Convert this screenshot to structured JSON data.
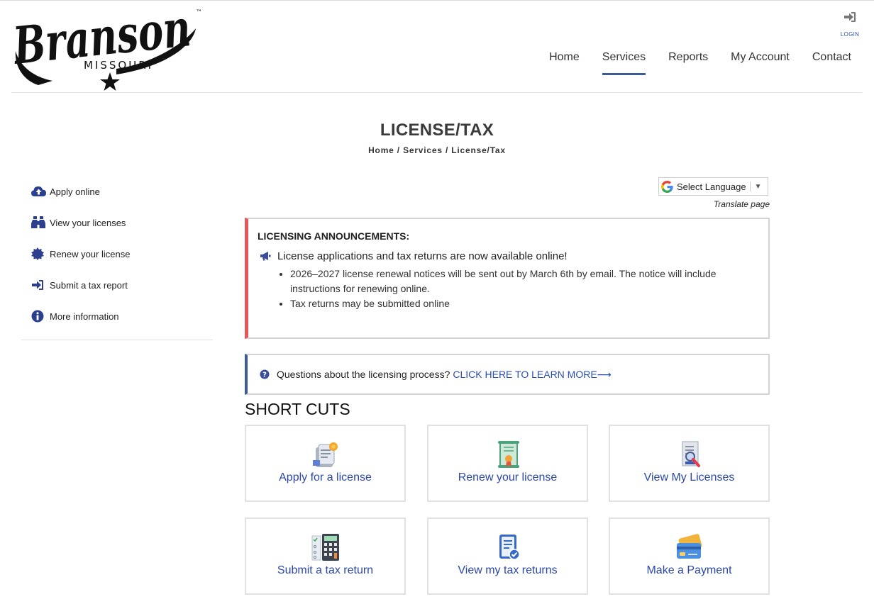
{
  "header": {
    "logo": {
      "brand": "Branson",
      "sub": "MISSOURI",
      "mark": "™"
    },
    "login_label": "LOGIN",
    "nav": [
      {
        "label": "Home"
      },
      {
        "label": "Services"
      },
      {
        "label": "Reports"
      },
      {
        "label": "My Account"
      },
      {
        "label": "Contact"
      }
    ]
  },
  "page": {
    "title": "LICENSE/TAX",
    "breadcrumb": [
      "Home",
      "Services",
      "License/Tax"
    ],
    "breadcrumb_separator": "/"
  },
  "sidebar": {
    "items": [
      {
        "label": "Apply online",
        "icon": "cloud-upload-icon"
      },
      {
        "label": "View your licenses",
        "icon": "binoculars-icon"
      },
      {
        "label": "Renew your license",
        "icon": "certificate-icon"
      },
      {
        "label": "Submit a tax report",
        "icon": "sign-in-icon"
      },
      {
        "label": "More information",
        "icon": "info-circle-icon"
      }
    ]
  },
  "translate": {
    "select_label": "Select Language",
    "note": "Translate page"
  },
  "announcement": {
    "heading": "LICENSING ANNOUNCEMENTS:",
    "main": "License applications and tax returns are now available online!",
    "bullets": [
      "2026–2027 license renewal notices will be sent out by March 6th by email. The notice will include instructions for renewing online.",
      "Tax returns may be submitted online"
    ]
  },
  "question": {
    "text": "Questions about the licensing process?",
    "link": "CLICK HERE TO LEARN MORE⟶"
  },
  "shortcuts": {
    "title": "SHORT CUTS",
    "cards": [
      {
        "label": "Apply for a license",
        "icon": "application-form-icon"
      },
      {
        "label": "Renew your license",
        "icon": "certificate-scroll-icon"
      },
      {
        "label": "View My Licenses",
        "icon": "document-search-icon"
      },
      {
        "label": "Submit a tax return",
        "icon": "calculator-checklist-icon"
      },
      {
        "label": "View my tax returns",
        "icon": "verified-document-icon"
      },
      {
        "label": "Make a Payment",
        "icon": "credit-card-icon"
      }
    ]
  },
  "colors": {
    "nav_active_underline": "#3c5a9a",
    "announcement_accent": "#e2575a",
    "question_accent": "#3c5a9a",
    "link_blue": "#2a4fb8",
    "sidebar_icon": "#2c3f8f"
  }
}
